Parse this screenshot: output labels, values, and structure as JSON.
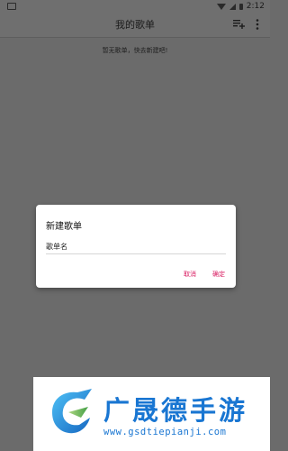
{
  "status_bar": {
    "time": "2:12"
  },
  "app_bar": {
    "title": "我的歌单"
  },
  "empty_state": {
    "text": "暂无歌单，快去新建吧!"
  },
  "dialog": {
    "title": "新建歌单",
    "field_label": "歌单名",
    "field_value": "",
    "cancel_label": "取消",
    "ok_label": "确定",
    "accent_color": "#d81b60"
  },
  "banner": {
    "brand": "广晟德手游",
    "url": "www.gsdtiepianji.com",
    "brand_color": "#1976d2"
  },
  "icons": [
    "menu-icon",
    "wifi-icon",
    "signal-icon",
    "battery-icon",
    "playlist-add-icon",
    "more-vert-icon",
    "brand-logo-icon"
  ]
}
